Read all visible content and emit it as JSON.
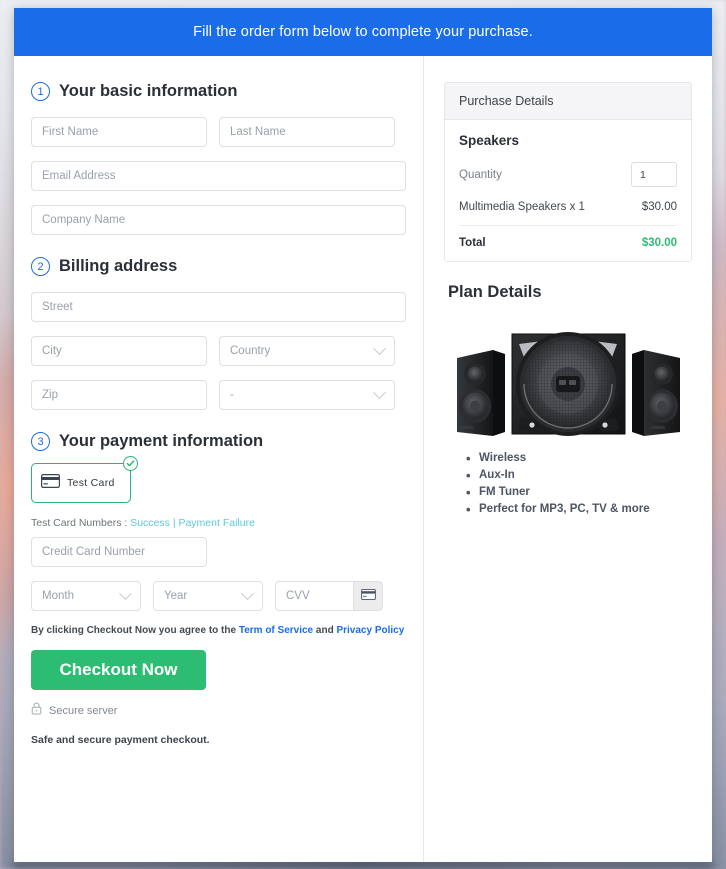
{
  "banner": {
    "message": "Fill the order form below to complete your purchase."
  },
  "steps": {
    "basic": {
      "number": "1",
      "title": "Your basic information",
      "fields": {
        "first_name": "First Name",
        "last_name": "Last Name",
        "email": "Email Address",
        "company": "Company Name"
      }
    },
    "billing": {
      "number": "2",
      "title": "Billing address",
      "fields": {
        "street": "Street",
        "city": "City",
        "country": "Country",
        "zip": "Zip",
        "state": "-"
      }
    },
    "payment": {
      "number": "3",
      "title": "Your payment information",
      "method_label": "Test Card",
      "method_icon": "credit-card-icon",
      "selected_badge_icon": "check-circle-icon",
      "test_card_prefix": "Test Card Numbers :",
      "test_card_success": "Success",
      "test_card_separator": "|",
      "test_card_failure": "Payment Failure",
      "fields": {
        "card_number": "Credit Card Number",
        "month": "Month",
        "year": "Year",
        "cvv": "CVV"
      },
      "cvv_icon": "credit-card-icon"
    }
  },
  "agreement": {
    "prefix": "By clicking Checkout Now you agree to the",
    "terms_link": "Term of Service",
    "conjunction": "and",
    "privacy_link": "Privacy Policy"
  },
  "checkout": {
    "label": "Checkout Now"
  },
  "secure": {
    "icon": "lock-icon",
    "label": "Secure server",
    "note": "Safe and secure payment checkout."
  },
  "purchase": {
    "header": "Purchase Details",
    "product": "Speakers",
    "quantity_label": "Quantity",
    "quantity_value": "1",
    "line_item_label": "Multimedia Speakers x 1",
    "line_item_price": "$30.00",
    "total_label": "Total",
    "total_value": "$30.00"
  },
  "plan": {
    "title": "Plan Details",
    "image_name": "multimedia-speakers-photo",
    "features": [
      "Wireless",
      "Aux-In",
      "FM Tuner",
      "Perfect for MP3, PC, TV & more"
    ]
  },
  "colors": {
    "banner_blue": "#1a6ce8",
    "accent_green": "#2dbd72",
    "link_teal": "#5bc8d8",
    "link_blue": "#1a6ce8"
  }
}
